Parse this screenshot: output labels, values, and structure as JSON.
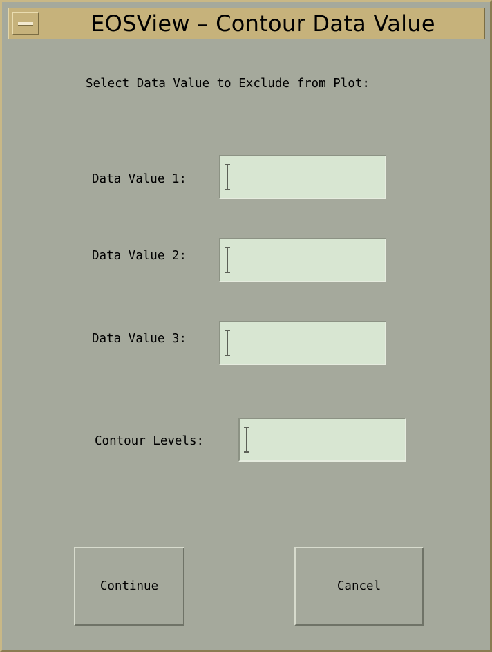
{
  "window": {
    "title": "EOSView – Contour Data Value"
  },
  "dialog": {
    "instruction": "Select Data Value to Exclude from Plot:",
    "fields": [
      {
        "label": "Data Value 1:",
        "value": ""
      },
      {
        "label": "Data Value 2:",
        "value": ""
      },
      {
        "label": "Data Value 3:",
        "value": ""
      },
      {
        "label": "Contour Levels:",
        "value": ""
      }
    ]
  },
  "buttons": {
    "continue_label": "Continue",
    "cancel_label": "Cancel"
  },
  "colors": {
    "background": "#a5a99c",
    "titlebar": "#c6b27b",
    "field": "#d8e6d2"
  },
  "icons": {
    "window_menu": "window-menu-icon",
    "text_cursor": "text-cursor-icon"
  }
}
